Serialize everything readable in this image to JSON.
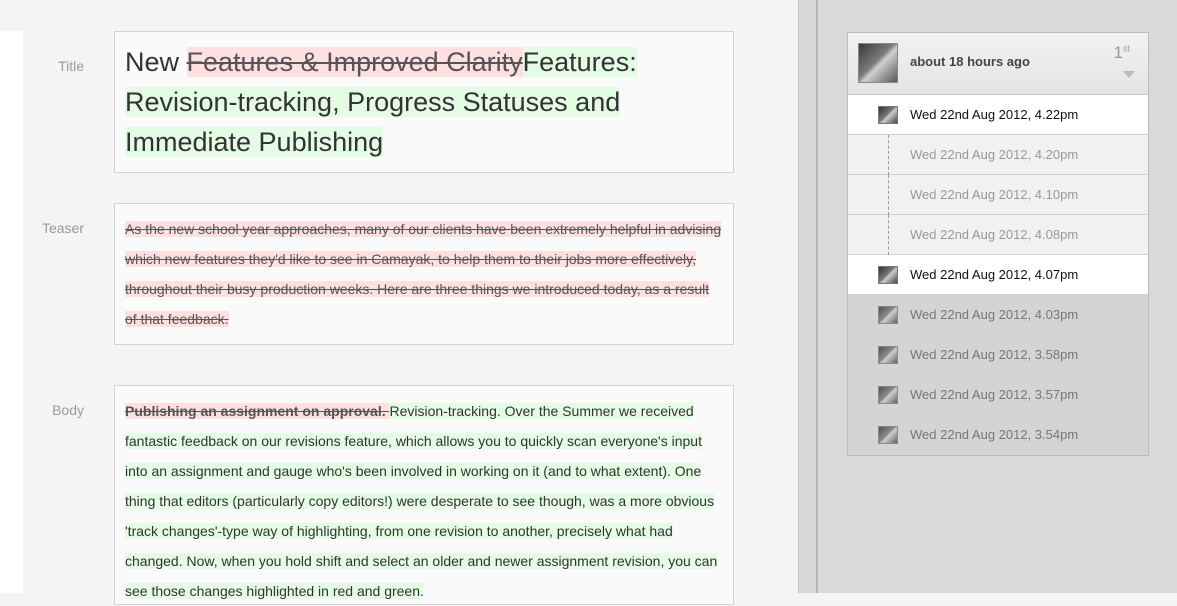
{
  "editor": {
    "labels": {
      "title": "Title",
      "teaser": "Teaser",
      "body": "Body"
    },
    "title": {
      "plain": "New ",
      "removed": "Features & Improved Clarity",
      "added": "Features: Revision-tracking, Progress Statuses and Immediate Publishing"
    },
    "teaser": {
      "removed": "As the new school year approaches, many of our clients have been extremely helpful in advising which new features they'd like to see in Camayak, to help them to their jobs more effectively, throughout their busy production weeks. Here are three things we introduced today, as a result of that feedback."
    },
    "body": {
      "removed": "Publishing an assignment on approval. ",
      "added": "Revision-tracking. Over the Summer we received fantastic feedback on our revisions feature, which allows you to quickly scan everyone's input into an assignment and gauge who's been involved in working on it (and to what extent). One thing that editors (particularly copy editors!) were desperate to see though, was a more obvious 'track changes'-type way of highlighting, from one revision to another, precisely what had changed. Now, when you hold shift and select an older and newer assignment revision, you can see those changes highlighted in red and green."
    }
  },
  "revisions": {
    "header_time": "about 18 hours ago",
    "count": "1",
    "count_suffix": "st",
    "rows": [
      {
        "label": "Wed 22nd Aug 2012, 4.22pm"
      },
      {
        "label": "Wed 22nd Aug 2012, 4.20pm"
      },
      {
        "label": "Wed 22nd Aug 2012, 4.10pm"
      },
      {
        "label": "Wed 22nd Aug 2012, 4.08pm"
      },
      {
        "label": "Wed 22nd Aug 2012, 4.07pm"
      },
      {
        "label": "Wed 22nd Aug 2012, 4.03pm"
      },
      {
        "label": "Wed 22nd Aug 2012, 3.58pm"
      },
      {
        "label": "Wed 22nd Aug 2012, 3.57pm"
      },
      {
        "label": "Wed 22nd Aug 2012, 3.54pm"
      }
    ]
  },
  "colors": {
    "removed_bg": "#ffe0e0",
    "added_bg": "#e4fbe4",
    "panel_bg": "#d9d9d9"
  },
  "icons": {
    "avatar": "user-avatar-icon",
    "chevron": "chevron-down-icon"
  }
}
